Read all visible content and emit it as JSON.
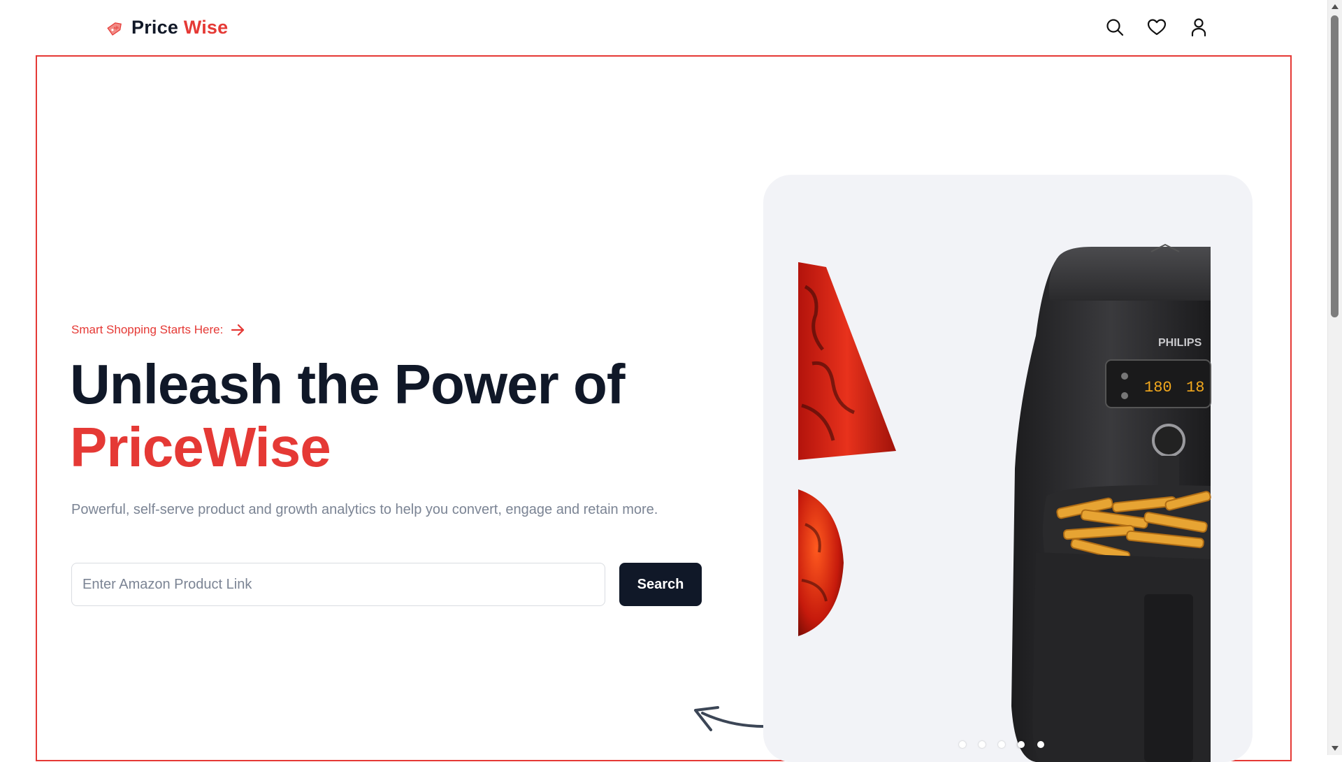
{
  "navbar": {
    "brand_first": "Price",
    "brand_second": "Wise",
    "icons": [
      "search-icon",
      "heart-icon",
      "user-icon"
    ]
  },
  "hero": {
    "tagline": "Smart Shopping Starts Here:",
    "headline_line1": "Unleash the Power of",
    "headline_brand": "PriceWise",
    "subtitle": "Powerful, self-serve product and growth analytics to help you convert, engage and retain more.",
    "search": {
      "placeholder": "Enter Amazon Product Link",
      "value": "",
      "button_label": "Search"
    }
  },
  "carousel": {
    "product_brand": "PHILIPS",
    "display_temp": "180",
    "display_time": "18",
    "slides_total": 5,
    "active_slide": 4
  },
  "colors": {
    "accent": "#e53935",
    "dark": "#101828",
    "muted": "#7b8494",
    "carousel_bg": "#f2f3f7"
  }
}
